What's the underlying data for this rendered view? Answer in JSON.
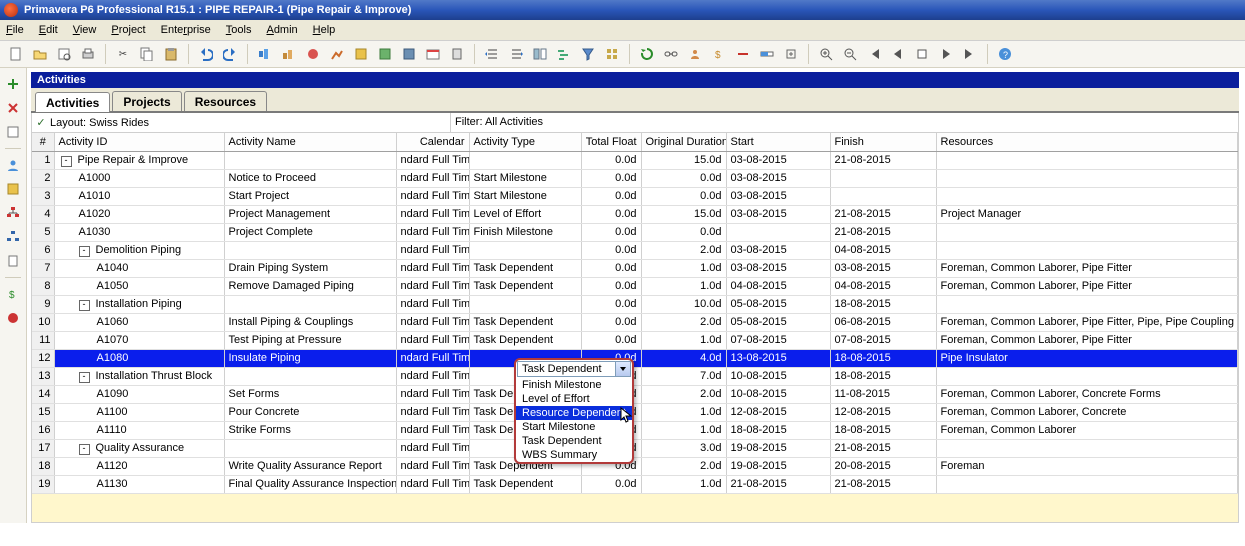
{
  "title": "Primavera P6 Professional R15.1 : PIPE REPAIR-1 (Pipe Repair & Improve)",
  "menu": [
    "File",
    "Edit",
    "View",
    "Project",
    "Enterprise",
    "Tools",
    "Admin",
    "Help"
  ],
  "view_title": "Activities",
  "tabs": [
    "Activities",
    "Projects",
    "Resources"
  ],
  "active_tab": 0,
  "layout_label": "Layout: Swiss Rides",
  "filter_label": "Filter: All Activities",
  "columns": [
    "#",
    "Activity ID",
    "Activity Name",
    "Calendar",
    "Activity Type",
    "Total Float",
    "Original Duration",
    "Start",
    "Finish",
    "Resources"
  ],
  "dropdown": {
    "value": "Task Dependent",
    "items": [
      "Finish Milestone",
      "Level of Effort",
      "Resource Dependent",
      "Start Milestone",
      "Task Dependent",
      "WBS Summary"
    ],
    "highlight_index": 2
  },
  "rows": [
    {
      "n": 1,
      "id": "Pipe Repair & Improve",
      "name": "",
      "cal": "ndard Full Time",
      "type": "",
      "float": "0.0d",
      "dur": "15.0d",
      "start": "03-08-2015",
      "finish": "21-08-2015",
      "res": "",
      "group": true,
      "indent": 0,
      "toggle": "-"
    },
    {
      "n": 2,
      "id": "A1000",
      "name": "Notice to Proceed",
      "cal": "ndard Full Time",
      "type": "Start Milestone",
      "float": "0.0d",
      "dur": "0.0d",
      "start": "03-08-2015",
      "finish": "",
      "res": "",
      "indent": 1
    },
    {
      "n": 3,
      "id": "A1010",
      "name": "Start Project",
      "cal": "ndard Full Time",
      "type": "Start Milestone",
      "float": "0.0d",
      "dur": "0.0d",
      "start": "03-08-2015",
      "finish": "",
      "res": "",
      "indent": 1
    },
    {
      "n": 4,
      "id": "A1020",
      "name": "Project Management",
      "cal": "ndard Full Time",
      "type": "Level of Effort",
      "float": "0.0d",
      "dur": "15.0d",
      "start": "03-08-2015",
      "finish": "21-08-2015",
      "res": "Project Manager",
      "indent": 1
    },
    {
      "n": 5,
      "id": "A1030",
      "name": "Project Complete",
      "cal": "ndard Full Time",
      "type": "Finish Milestone",
      "float": "0.0d",
      "dur": "0.0d",
      "start": "",
      "finish": "21-08-2015",
      "res": "",
      "indent": 1
    },
    {
      "n": 6,
      "id": "Demolition Piping",
      "name": "",
      "cal": "ndard Full Time",
      "type": "",
      "float": "0.0d",
      "dur": "2.0d",
      "start": "03-08-2015",
      "finish": "04-08-2015",
      "res": "",
      "group": true,
      "indent": 1,
      "toggle": "-"
    },
    {
      "n": 7,
      "id": "A1040",
      "name": "Drain Piping System",
      "cal": "ndard Full Time",
      "type": "Task Dependent",
      "float": "0.0d",
      "dur": "1.0d",
      "start": "03-08-2015",
      "finish": "03-08-2015",
      "res": "Foreman, Common Laborer, Pipe Fitter",
      "indent": 2
    },
    {
      "n": 8,
      "id": "A1050",
      "name": "Remove Damaged Piping",
      "cal": "ndard Full Time",
      "type": "Task Dependent",
      "float": "0.0d",
      "dur": "1.0d",
      "start": "04-08-2015",
      "finish": "04-08-2015",
      "res": "Foreman, Common Laborer, Pipe Fitter",
      "indent": 2
    },
    {
      "n": 9,
      "id": "Installation Piping",
      "name": "",
      "cal": "ndard Full Time",
      "type": "",
      "float": "0.0d",
      "dur": "10.0d",
      "start": "05-08-2015",
      "finish": "18-08-2015",
      "res": "",
      "group": true,
      "indent": 1,
      "toggle": "-"
    },
    {
      "n": 10,
      "id": "A1060",
      "name": "Install Piping & Couplings",
      "cal": "ndard Full Time",
      "type": "Task Dependent",
      "float": "0.0d",
      "dur": "2.0d",
      "start": "05-08-2015",
      "finish": "06-08-2015",
      "res": "Foreman, Common Laborer, Pipe Fitter, Pipe, Pipe Coupling",
      "indent": 2
    },
    {
      "n": 11,
      "id": "A1070",
      "name": "Test Piping at Pressure",
      "cal": "ndard Full Time",
      "type": "Task Dependent",
      "float": "0.0d",
      "dur": "1.0d",
      "start": "07-08-2015",
      "finish": "07-08-2015",
      "res": "Foreman, Common Laborer, Pipe Fitter",
      "indent": 2
    },
    {
      "n": 12,
      "id": "A1080",
      "name": "Insulate Piping",
      "cal": "ndard Full Time",
      "type": "",
      "float": "0.0d",
      "dur": "4.0d",
      "start": "13-08-2015",
      "finish": "18-08-2015",
      "res": "Pipe Insulator",
      "indent": 2,
      "selected": true
    },
    {
      "n": 13,
      "id": "Installation Thrust Block",
      "name": "",
      "cal": "ndard Full Time",
      "type": "",
      "float": "0.0d",
      "dur": "7.0d",
      "start": "10-08-2015",
      "finish": "18-08-2015",
      "res": "",
      "group": true,
      "indent": 1,
      "toggle": "-"
    },
    {
      "n": 14,
      "id": "A1090",
      "name": "Set Forms",
      "cal": "ndard Full Time",
      "type": "Task Dependent",
      "float": "0.0d",
      "dur": "2.0d",
      "start": "10-08-2015",
      "finish": "11-08-2015",
      "res": "Foreman, Common Laborer, Concrete Forms",
      "indent": 2
    },
    {
      "n": 15,
      "id": "A1100",
      "name": "Pour Concrete",
      "cal": "ndard Full Time",
      "type": "Task Dependent",
      "float": "0.0d",
      "dur": "1.0d",
      "start": "12-08-2015",
      "finish": "12-08-2015",
      "res": "Foreman, Common Laborer, Concrete",
      "indent": 2
    },
    {
      "n": 16,
      "id": "A1110",
      "name": "Strike Forms",
      "cal": "ndard Full Time",
      "type": "Task Dependent",
      "float": "0.0d",
      "dur": "1.0d",
      "start": "18-08-2015",
      "finish": "18-08-2015",
      "res": "Foreman, Common Laborer",
      "indent": 2
    },
    {
      "n": 17,
      "id": "Quality Assurance",
      "name": "",
      "cal": "ndard Full Time",
      "type": "",
      "float": "0.0d",
      "dur": "3.0d",
      "start": "19-08-2015",
      "finish": "21-08-2015",
      "res": "",
      "group": true,
      "indent": 1,
      "toggle": "-"
    },
    {
      "n": 18,
      "id": "A1120",
      "name": "Write Quality Assurance Report",
      "cal": "ndard Full Time",
      "type": "Task Dependent",
      "float": "0.0d",
      "dur": "2.0d",
      "start": "19-08-2015",
      "finish": "20-08-2015",
      "res": "Foreman",
      "indent": 2
    },
    {
      "n": 19,
      "id": "A1130",
      "name": "Final Quality Assurance Inspection",
      "cal": "ndard Full Time",
      "type": "Task Dependent",
      "float": "0.0d",
      "dur": "1.0d",
      "start": "21-08-2015",
      "finish": "21-08-2015",
      "res": "",
      "indent": 2
    }
  ]
}
